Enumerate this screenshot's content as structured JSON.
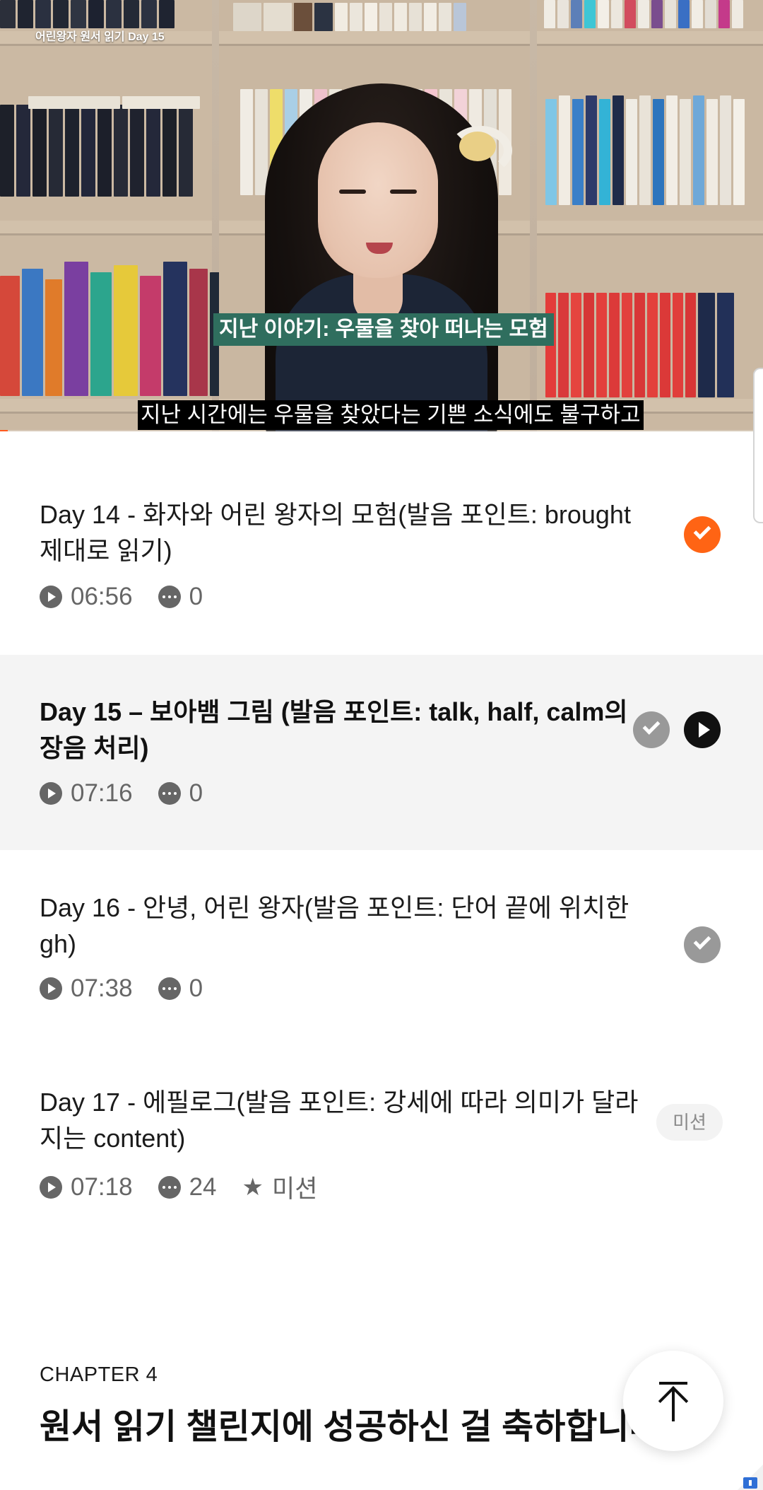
{
  "video": {
    "title_overlay": "어린왕자 원서 읽기 Day 15",
    "caption_top": "지난 이야기: 우물을 찾아 떠나는 모험",
    "caption_bottom": "지난 시간에는 우물을 찾았다는 기쁜 소식에도 불구하고",
    "progress_fraction": 0.01
  },
  "episodes": [
    {
      "title": "Day 14 - 화자와 어린 왕자의 모험(발음 포인트: brought 제대로 읽기)",
      "duration": "06:56",
      "comments": "0",
      "status": "completed",
      "active": false
    },
    {
      "title": "Day 15 – 보아뱀 그림 (발음 포인트: talk, half, calm의 장음 처리)",
      "duration": "07:16",
      "comments": "0",
      "status": "playing",
      "active": true
    },
    {
      "title": "Day 16 - 안녕, 어린 왕자(발음 포인트: 단어 끝에 위치한 gh)",
      "duration": "07:38",
      "comments": "0",
      "status": "checked",
      "active": false
    },
    {
      "title": "Day 17 - 에필로그(발음 포인트: 강세에 따라 의미가 달라지는 content)",
      "duration": "07:18",
      "comments": "24",
      "mission_label": "미션",
      "mission_badge": "미션",
      "status": "mission",
      "active": false
    }
  ],
  "chapter": {
    "label": "CHAPTER 4",
    "title": "원서 읽기 챌린지에 성공하신 걸 축하합니다"
  },
  "icons": {
    "play": "play-circle-icon",
    "comment": "comment-bubble-icon",
    "star": "star-icon",
    "scroll_top": "arrow-up-to-top-icon",
    "completed": "check-circle-icon"
  },
  "colors": {
    "accent": "#ff6414",
    "active_row_bg": "#f4f4f4",
    "caption_green": "#2f6e5e"
  }
}
